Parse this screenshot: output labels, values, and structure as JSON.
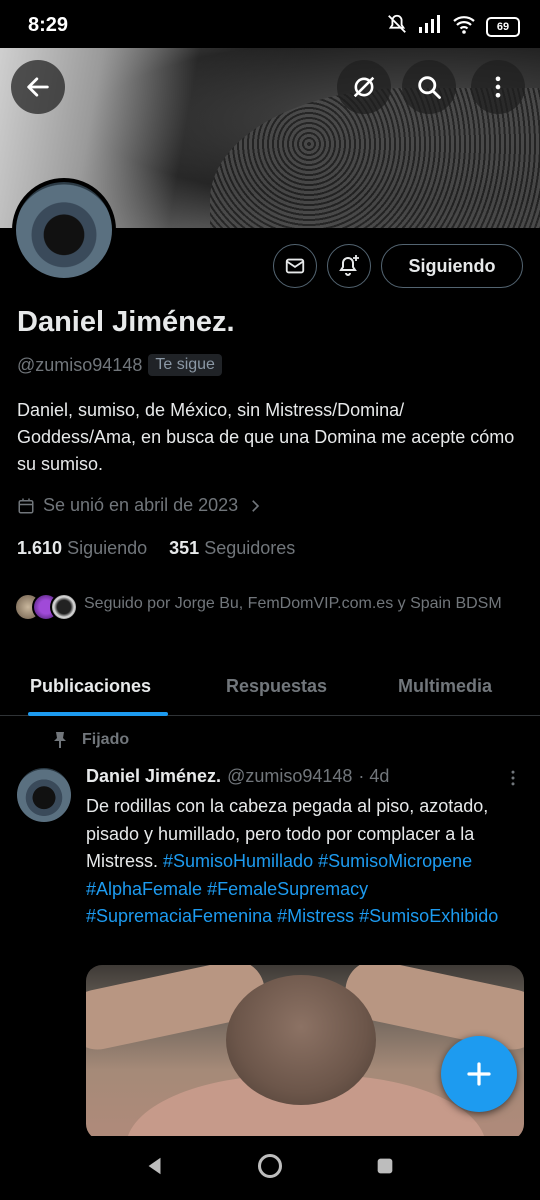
{
  "status_bar": {
    "time": "8:29",
    "battery": "69"
  },
  "profile": {
    "display_name": "Daniel Jiménez.",
    "handle": "@zumiso94148",
    "follows_you": "Te sigue",
    "bio": "Daniel, sumiso, de México, sin Mistress/Domina/ Goddess/Ama, en busca de que una Domina me acepte cómo su sumiso.",
    "joined": "Se unió en abril de 2023",
    "following_count": "1.610",
    "following_label": "Siguiendo",
    "followers_count": "351",
    "followers_label": "Seguidores",
    "followed_by": "Seguido por Jorge Bu, FemDomVIP.com.es y Spain BDSM",
    "follow_button": "Siguiendo"
  },
  "tabs": [
    {
      "label": "Publicaciones",
      "active": true
    },
    {
      "label": "Respuestas",
      "active": false
    },
    {
      "label": "Multimedia",
      "active": false
    }
  ],
  "pinned_tweet": {
    "pinned_label": "Fijado",
    "name": "Daniel Jiménez.",
    "handle": "@zumiso94148",
    "time": "· 4d",
    "text_lines": [
      "De rodillas con la cabeza pegada al piso,",
      "azotado, pisado y humillado, pero todo por",
      "complacer a la Mistress. "
    ],
    "hashtags": [
      "#SumisoHumillado",
      "#SumisoMicropene",
      "#AlphaFemale",
      "#FemaleSupremacy",
      "#SupremaciaFemenina",
      "#Mistress",
      "#SumisoExhibido"
    ]
  },
  "colors": {
    "accent": "#1d9bf0",
    "muted": "#71767b",
    "text": "#e7e9ea",
    "background": "#000000"
  }
}
